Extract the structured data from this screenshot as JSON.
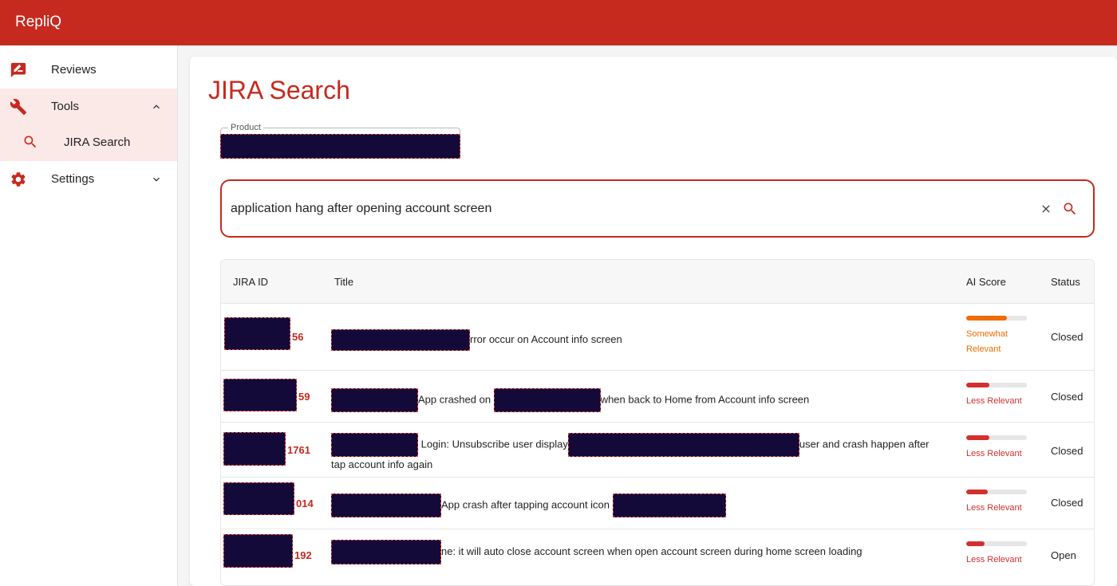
{
  "app": {
    "title": "RepliQ"
  },
  "colors": {
    "brand": "#c62a1e",
    "somewhat": "#ef6c00",
    "less": "#d32f2f",
    "redaction": "#140a3a"
  },
  "sidebar": {
    "items": [
      {
        "label": "Reviews",
        "icon": "reviews-icon"
      },
      {
        "label": "Tools",
        "icon": "wrench-icon",
        "expanded": true
      },
      {
        "label": "JIRA Search",
        "icon": "search-icon",
        "selected": true
      },
      {
        "label": "Settings",
        "icon": "gear-icon",
        "expanded": false
      }
    ]
  },
  "page": {
    "title": "JIRA Search"
  },
  "product": {
    "label": "Product",
    "value": ""
  },
  "search": {
    "query": "application hang after opening account screen"
  },
  "table": {
    "headers": [
      "JIRA ID",
      "Title",
      "AI Score",
      "Status"
    ],
    "rows": [
      {
        "id_suffix": "56",
        "title_parts": [
          "rror occur on Account info screen"
        ],
        "score_label": "Somewhat Relevant",
        "score": 0.67,
        "status": "Closed"
      },
      {
        "id_suffix": "59",
        "title_parts": [
          "App crashed on ",
          "when back to Home from Account info screen"
        ],
        "score_label": "Less Relevant",
        "score": 0.38,
        "status": "Closed"
      },
      {
        "id_suffix": "1761",
        "title_parts": [
          " Login: Unsubscribe user display",
          "user and crash happen after tap account info again"
        ],
        "score_label": "Less Relevant",
        "score": 0.38,
        "status": "Closed"
      },
      {
        "id_suffix": "014",
        "title_parts": [
          "App crash after tapping account icon "
        ],
        "score_label": "Less Relevant",
        "score": 0.36,
        "status": "Closed"
      },
      {
        "id_suffix": "192",
        "title_parts": [
          "ne: it will auto close account screen when open account screen during home screen loading"
        ],
        "score_label": "Less Relevant",
        "score": 0.3,
        "status": "Open"
      }
    ]
  }
}
